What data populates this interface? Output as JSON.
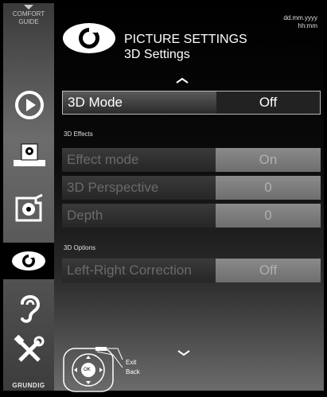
{
  "sidebar": {
    "comfort_guide_line1": "COMFORT",
    "comfort_guide_line2": "GUIDE",
    "brand": "GRUNDIG",
    "items": [
      {
        "icon": "source-icon"
      },
      {
        "icon": "media-icon"
      },
      {
        "icon": "settings-icon"
      },
      {
        "icon": "picture-eye-icon",
        "active": true
      },
      {
        "icon": "sound-ear-icon"
      },
      {
        "icon": "tools-icon"
      }
    ]
  },
  "header": {
    "date": "dd.mm.yyyy",
    "time": "hh:mm",
    "title": "PICTURE SETTINGS",
    "subtitle": "3D Settings"
  },
  "menu": {
    "mode_row": {
      "label": "3D Mode",
      "value": "Off"
    },
    "effects_section": "3D Effects",
    "effect_rows": [
      {
        "label": "Effect mode",
        "value": "On"
      },
      {
        "label": "3D Perspective",
        "value": "0"
      },
      {
        "label": "Depth",
        "value": "0"
      }
    ],
    "options_section": "3D Options",
    "options_rows": [
      {
        "label": "Left-Right Correction",
        "value": "Off"
      }
    ]
  },
  "remote": {
    "ok_label": "OK",
    "exit_label": "Exit",
    "back_label": "Back"
  },
  "colors": {
    "selected_border": "#bbbbbb",
    "dim_value": "#7a7a7a",
    "background": "#000000"
  }
}
